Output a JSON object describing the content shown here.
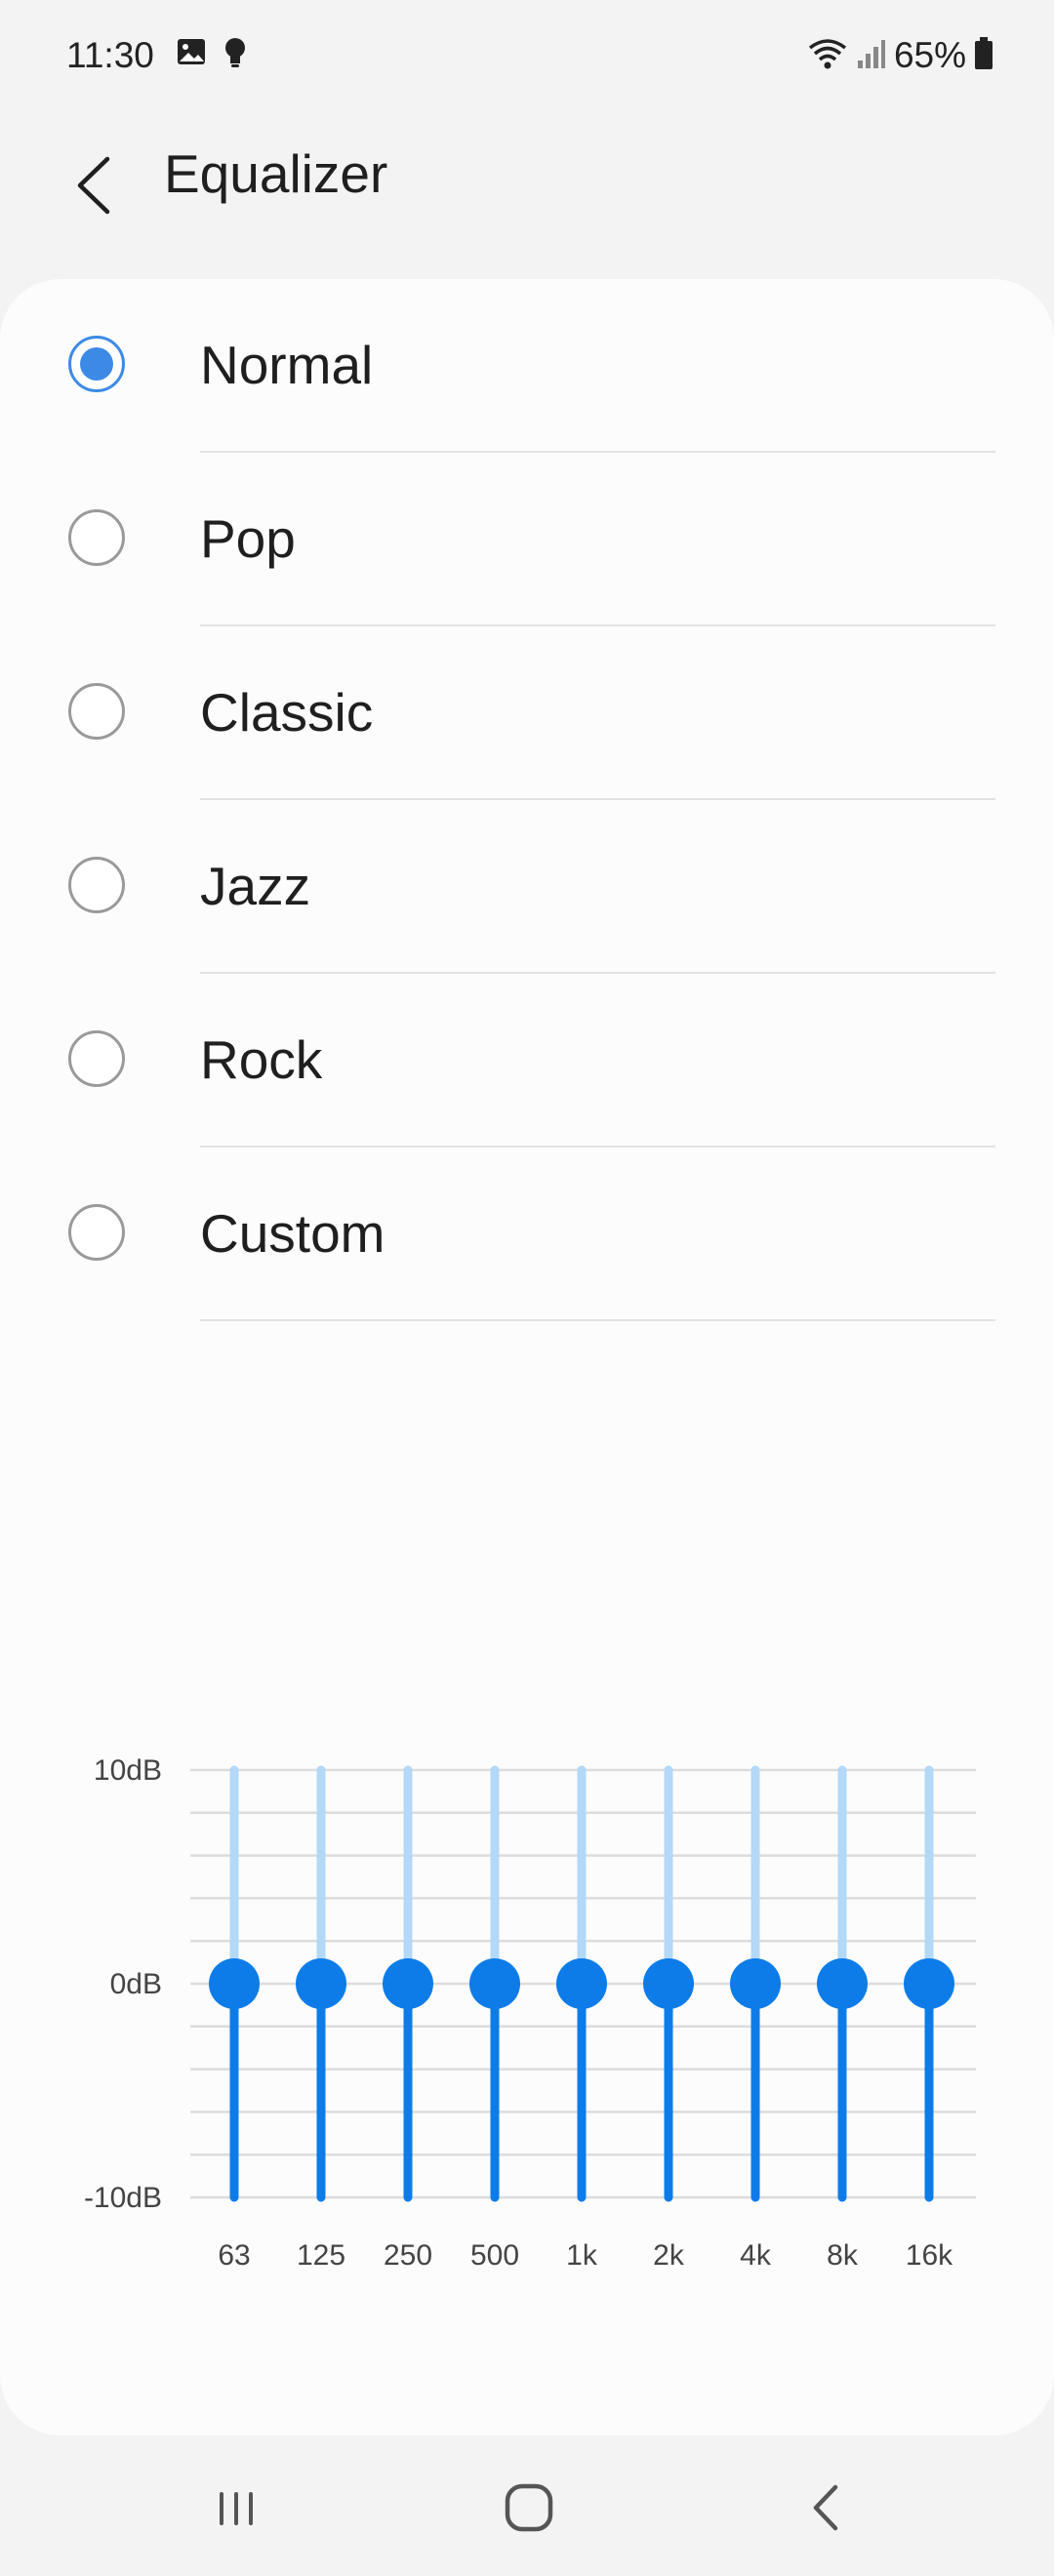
{
  "status_bar": {
    "time": "11:30",
    "battery": "65%",
    "left_icons": [
      "image-icon",
      "lightbulb-icon"
    ],
    "right_icons": [
      "wifi-icon",
      "signal-icon",
      "battery-icon"
    ]
  },
  "header": {
    "back_icon": "chevron-left-icon",
    "title": "Equalizer"
  },
  "presets": [
    {
      "label": "Normal",
      "selected": true
    },
    {
      "label": "Pop",
      "selected": false
    },
    {
      "label": "Classic",
      "selected": false
    },
    {
      "label": "Jazz",
      "selected": false
    },
    {
      "label": "Rock",
      "selected": false
    },
    {
      "label": "Custom",
      "selected": false
    }
  ],
  "equalizer": {
    "y_labels": [
      "10dB",
      "0dB",
      "-10dB"
    ],
    "range_db": [
      -10,
      10
    ],
    "bands": [
      {
        "label": "63",
        "gain_db": 0
      },
      {
        "label": "125",
        "gain_db": 0
      },
      {
        "label": "250",
        "gain_db": 0
      },
      {
        "label": "500",
        "gain_db": 0
      },
      {
        "label": "1k",
        "gain_db": 0
      },
      {
        "label": "2k",
        "gain_db": 0
      },
      {
        "label": "4k",
        "gain_db": 0
      },
      {
        "label": "8k",
        "gain_db": 0
      },
      {
        "label": "16k",
        "gain_db": 0
      }
    ],
    "colors": {
      "active_track": "#0d7ce8",
      "inactive_track": "#b3d8f8",
      "thumb": "#0d7ce8",
      "grid": "#dcdcdc",
      "label": "#444444"
    }
  },
  "nav_bar": {
    "icons": [
      "recent-apps-icon",
      "home-icon",
      "back-icon"
    ]
  }
}
